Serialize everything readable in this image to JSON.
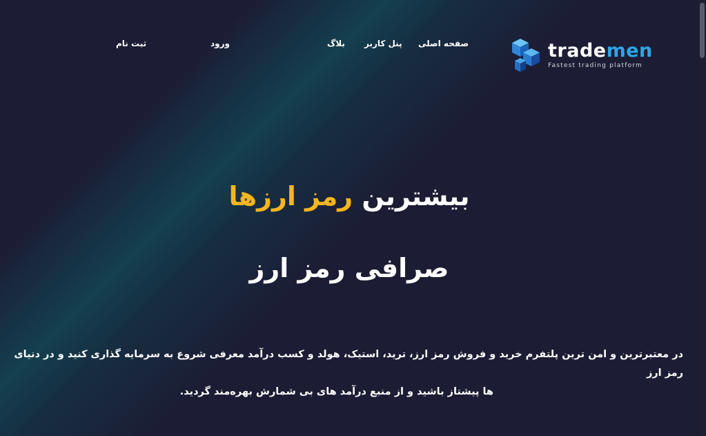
{
  "header": {
    "brand_part1": "trade",
    "brand_part2": "men",
    "tagline": "Fastest trading platform",
    "nav": {
      "home": "صفحه اصلی",
      "user_panel": "پنل کاربر",
      "blog": "بلاگ",
      "login": "ورود",
      "register": "ثبت نام"
    }
  },
  "hero": {
    "title_main": "بیشترین ",
    "title_accent": "رمز ارزها",
    "subtitle": "صرافی رمز ارز",
    "description_line1": "در معتبرترین و امن ترین پلتفرم خرید و فروش رمز ارز، ترید، استیک، هولد و کسب درآمد معرفی شروع به سرمایه گذاری کنید و در دنیای رمز ارز",
    "description_line2": "ها پیشتاز باشید و از منبع درآمد های بی شمارش بهره‌مند گردید."
  },
  "colors": {
    "background": "#1c1c34",
    "accent_yellow": "#f7b51f",
    "brand_blue": "#2aa7e6",
    "glow_teal": "#124654"
  },
  "icons": {
    "logo": "stacked-cubes-logo-icon"
  }
}
